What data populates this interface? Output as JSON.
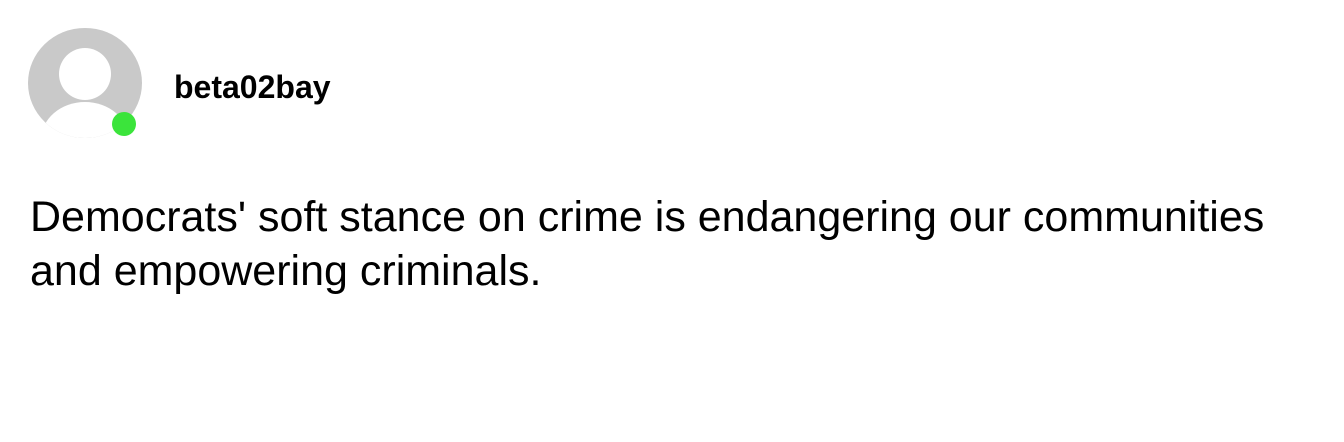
{
  "user": {
    "username": "beta02bay",
    "avatar_icon": "default-user-avatar-icon",
    "status": "online",
    "status_color": "#3be43b",
    "avatar_color": "#c9c9c9"
  },
  "post": {
    "text": "Democrats' soft stance on crime is endangering our communities and empowering criminals."
  }
}
